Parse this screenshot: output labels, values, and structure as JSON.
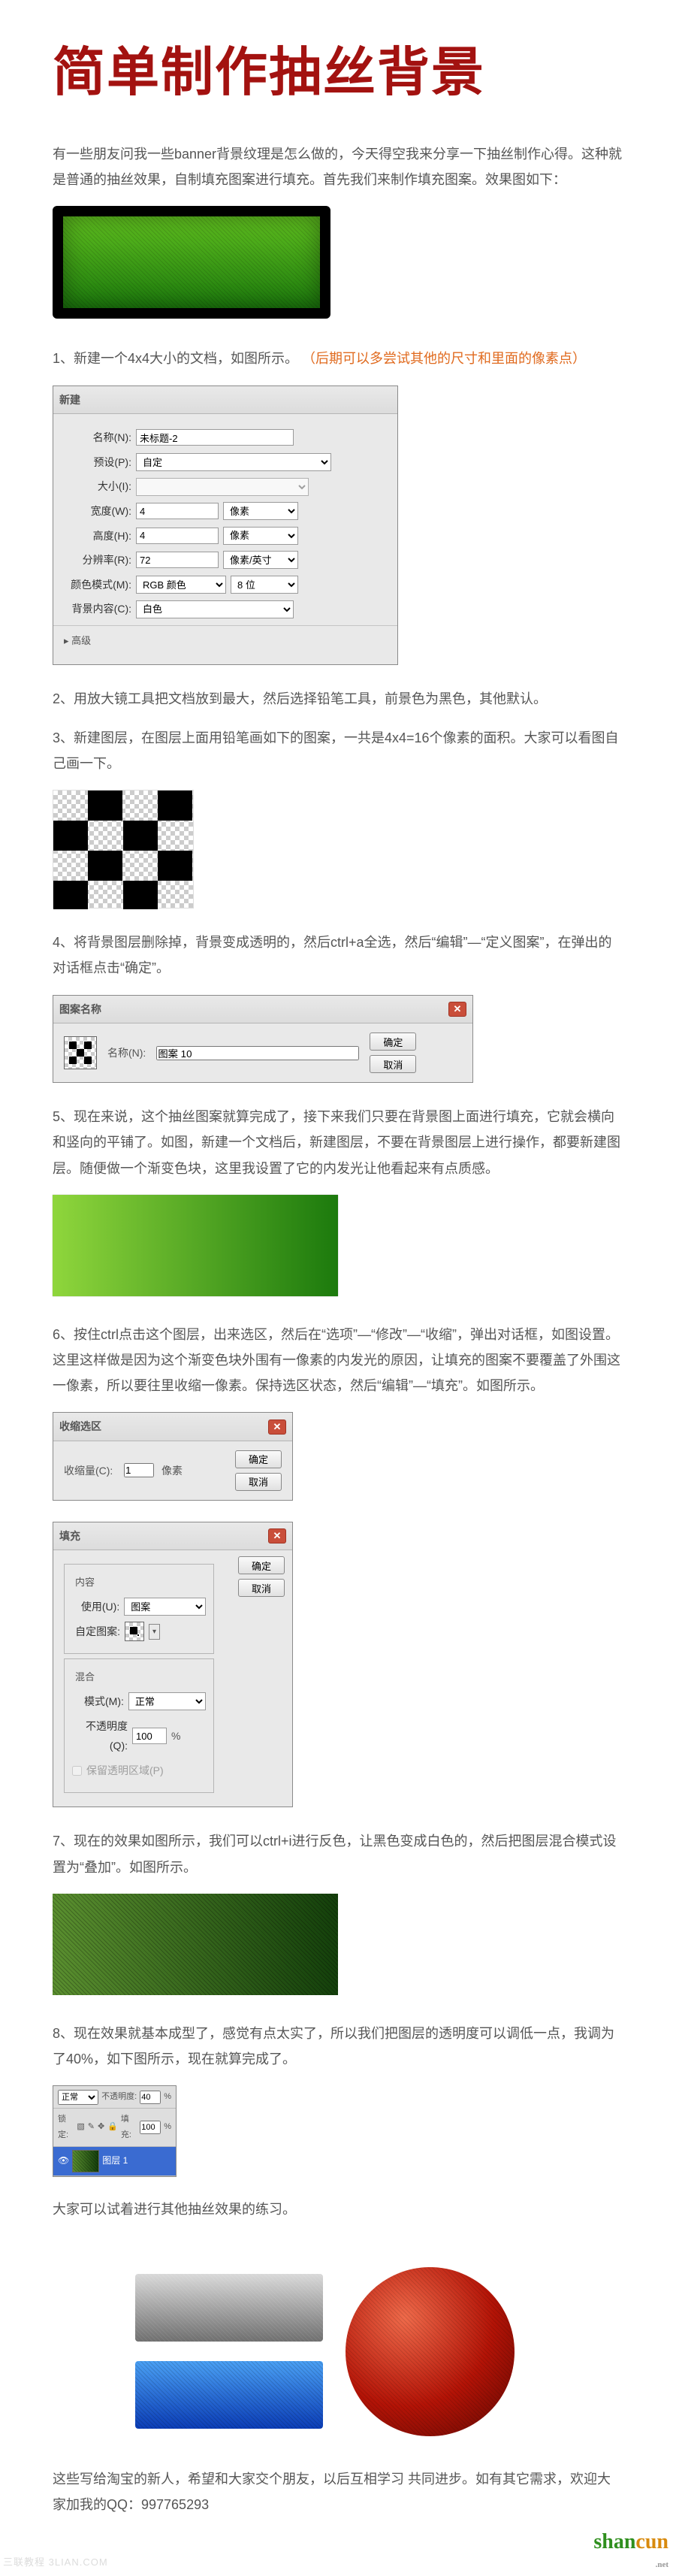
{
  "title": "简单制作抽丝背景",
  "intro": "有一些朋友问我一些banner背景纹理是怎么做的，今天得空我来分享一下抽丝制作心得。这种就是普通的抽丝效果，自制填充图案进行填充。首先我们来制作填充图案。效果图如下：",
  "step1": {
    "text": "1、新建一个4x4大小的文档，如图所示。",
    "note": "（后期可以多尝试其他的尺寸和里面的像素点）"
  },
  "newDialog": {
    "title": "新建",
    "name_label": "名称(N):",
    "name_value": "未标题-2",
    "preset_label": "预设(P):",
    "preset_value": "自定",
    "size_label": "大小(I):",
    "width_label": "宽度(W):",
    "width_value": "4",
    "width_unit": "像素",
    "height_label": "高度(H):",
    "height_value": "4",
    "height_unit": "像素",
    "res_label": "分辨率(R):",
    "res_value": "72",
    "res_unit": "像素/英寸",
    "mode_label": "颜色模式(M):",
    "mode_value": "RGB 颜色",
    "mode_bits": "8 位",
    "bg_label": "背景内容(C):",
    "bg_value": "白色",
    "advanced": "高级"
  },
  "step2": "2、用放大镜工具把文档放到最大，然后选择铅笔工具，前景色为黑色，其他默认。",
  "step3": "3、新建图层，在图层上面用铅笔画如下的图案，一共是4x4=16个像素的面积。大家可以看图自己画一下。",
  "step4": "4、将背景图层删除掉，背景变成透明的，然后ctrl+a全选，然后“编辑”—“定义图案”，在弹出的对话框点击“确定”。",
  "patternDialog": {
    "title": "图案名称",
    "name_label": "名称(N):",
    "name_value": "图案 10",
    "ok": "确定",
    "cancel": "取消"
  },
  "step5": "5、现在来说，这个抽丝图案就算完成了，接下来我们只要在背景图上面进行填充，它就会横向和竖向的平铺了。如图，新建一个文档后，新建图层，不要在背景图层上进行操作，都要新建图层。随便做一个渐变色块，这里我设置了它的内发光让他看起来有点质感。",
  "step6": "6、按住ctrl点击这个图层，出来选区，然后在“选项”—“修改”—“收缩”，弹出对话框，如图设置。这里这样做是因为这个渐变色块外围有一像素的内发光的原因，让填充的图案不要覆盖了外围这一像素，所以要往里收缩一像素。保持选区状态，然后“编辑”—“填充”。如图所示。",
  "contractDialog": {
    "title": "收缩选区",
    "amount_label": "收缩量(C):",
    "amount_value": "1",
    "unit": "像素",
    "ok": "确定",
    "cancel": "取消"
  },
  "fillDialog": {
    "title": "填充",
    "contents": "内容",
    "use_label": "使用(U):",
    "use_value": "图案",
    "custom_label": "自定图案:",
    "blend": "混合",
    "mode_label": "模式(M):",
    "mode_value": "正常",
    "opacity_label": "不透明度(Q):",
    "opacity_value": "100",
    "opacity_unit": "%",
    "preserve": "保留透明区域(P)",
    "ok": "确定",
    "cancel": "取消"
  },
  "step7": "7、现在的效果如图所示，我们可以ctrl+i进行反色，让黑色变成白色的，然后把图层混合模式设置为“叠加”。如图所示。",
  "step8": "8、现在效果就基本成型了，感觉有点太实了，所以我们把图层的透明度可以调低一点，我调为了40%，如下图所示，现在就算完成了。",
  "layersPanel": {
    "mode": "正常",
    "opacity_label": "不透明度:",
    "opacity_value": "40",
    "opacity_unit": "%",
    "lock_label": "锁定:",
    "fill_label": "填充:",
    "fill_value": "100",
    "fill_unit": "%",
    "layer_name": "图层 1"
  },
  "closing1": "大家可以试着进行其他抽丝效果的练习。",
  "closing2": "这些写给淘宝的新人，希望和大家交个朋友，以后互相学习 共同进步。如有其它需求，欢迎大家加我的QQ：997765293",
  "wm_left": "三联教程 3LIAN.COM",
  "wm_right": {
    "green": "shan",
    "orange": "cun",
    "sub": ".net"
  }
}
